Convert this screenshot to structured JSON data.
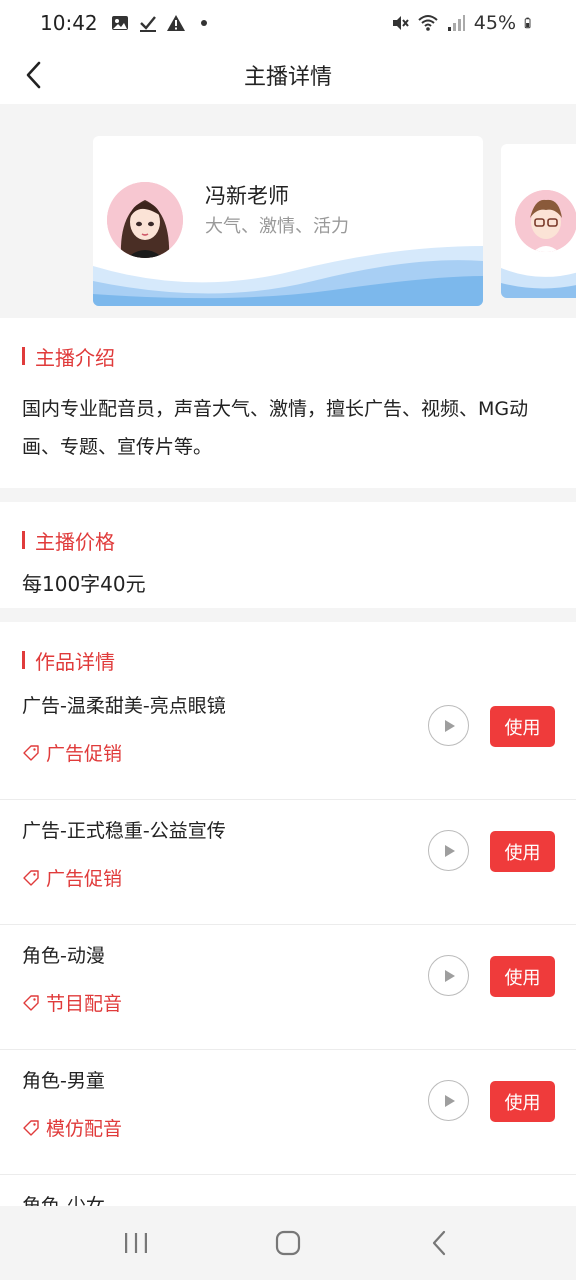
{
  "status_bar": {
    "time": "10:42",
    "battery": "45%",
    "icons_left": [
      "image-icon",
      "check-icon",
      "warning-icon",
      "dot-icon"
    ],
    "icons_right": [
      "mute-icon",
      "wifi-icon",
      "signal-icon",
      "battery-icon"
    ]
  },
  "header": {
    "title": "主播详情"
  },
  "carousel": {
    "cards": [
      {
        "name": "冯新老师",
        "tags": "大气、激情、活力"
      }
    ]
  },
  "intro": {
    "heading": "主播介绍",
    "text": "国内专业配音员，声音大气、激情，擅长广告、视频、MG动画、专题、宣传片等。"
  },
  "price": {
    "heading": "主播价格",
    "text": "每100字40元"
  },
  "works": {
    "heading": "作品详情",
    "use_label": "使用",
    "items": [
      {
        "title": "广告-温柔甜美-亮点眼镜",
        "tag": "广告促销"
      },
      {
        "title": "广告-正式稳重-公益宣传",
        "tag": "广告促销"
      },
      {
        "title": "角色-动漫",
        "tag": "节目配音"
      },
      {
        "title": "角色-男童",
        "tag": "模仿配音"
      },
      {
        "title": "角色-少女",
        "tag": ""
      }
    ]
  },
  "colors": {
    "accent": "#e03b3b",
    "button": "#ef3b3b",
    "background": "#f4f4f4"
  }
}
